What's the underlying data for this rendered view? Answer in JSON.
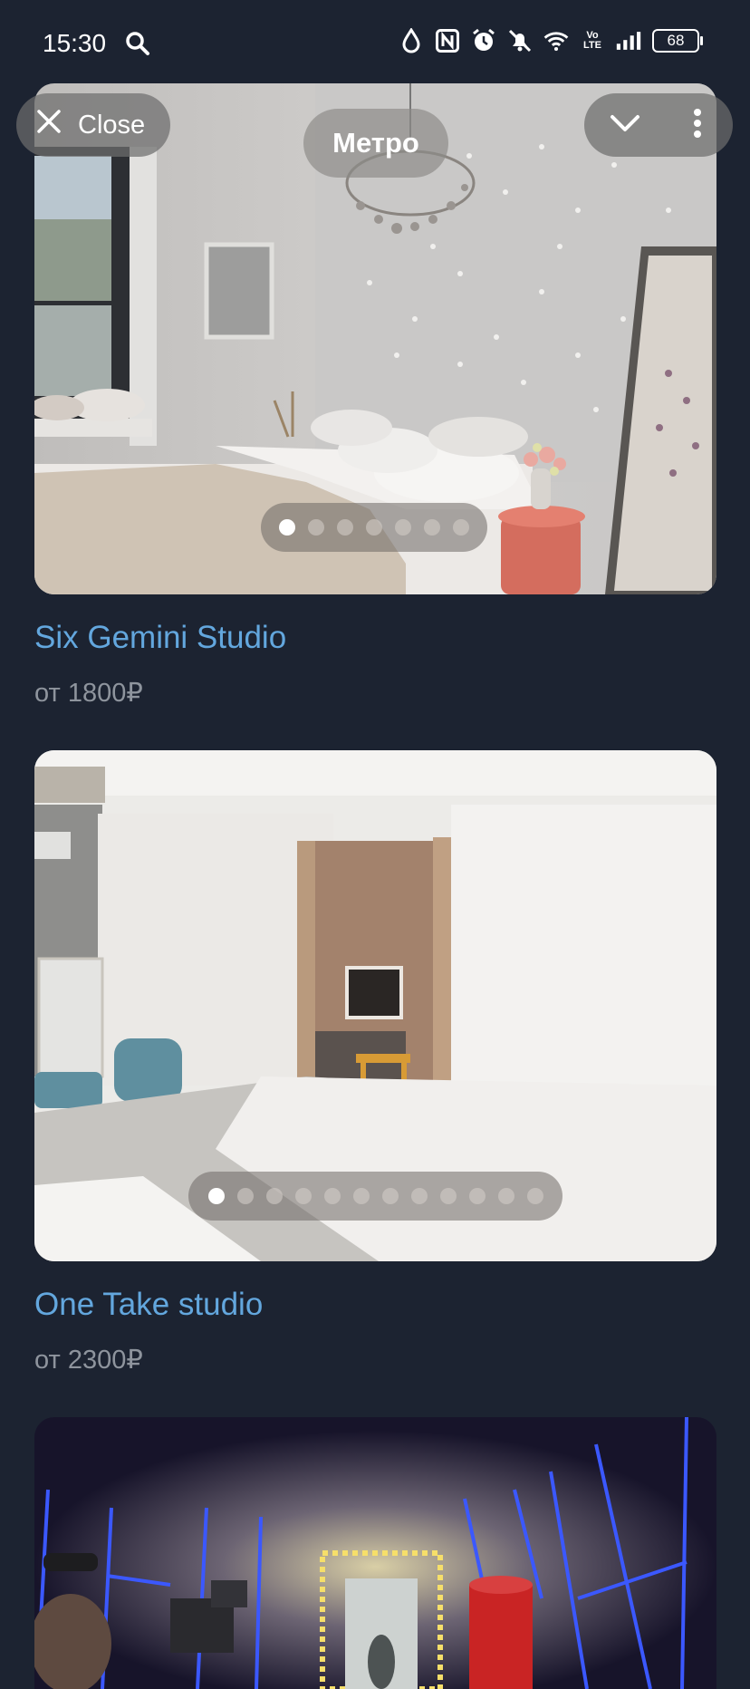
{
  "status_bar": {
    "time": "15:30",
    "volte": "Vo LTE",
    "battery": "68",
    "icons": [
      "search-icon",
      "water-drop-icon",
      "nfc-icon",
      "alarm-icon",
      "bell-off-icon",
      "wifi-icon",
      "volte-icon",
      "signal-icon",
      "battery-icon"
    ]
  },
  "header": {
    "close_label": "Close",
    "title": "Метро"
  },
  "listings": [
    {
      "name": "Six Gemini Studio",
      "price": "от 1800₽",
      "photo_count": 7,
      "active_photo": 1
    },
    {
      "name": "One Take studio",
      "price": "от 2300₽",
      "photo_count": 12,
      "active_photo": 1
    },
    {
      "name": "",
      "price": ""
    }
  ],
  "colors": {
    "background": "#1c2331",
    "title": "#63a7de",
    "price": "#8e949d"
  }
}
